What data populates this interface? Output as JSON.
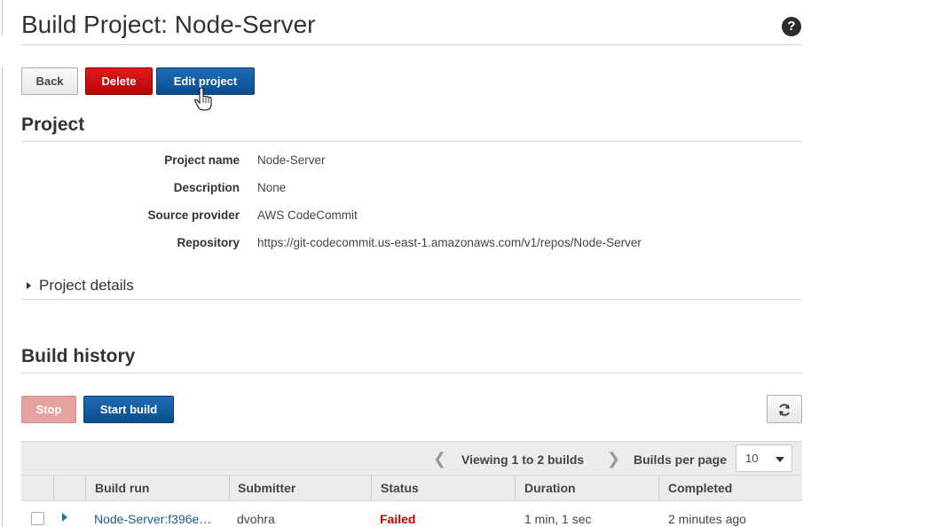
{
  "page": {
    "title": "Build Project: Node-Server",
    "help_icon": "question-circle-icon"
  },
  "actions": {
    "back_label": "Back",
    "delete_label": "Delete",
    "edit_label": "Edit project"
  },
  "project": {
    "section_title": "Project",
    "fields": [
      {
        "label": "Project name",
        "value": "Node-Server"
      },
      {
        "label": "Description",
        "value": "None"
      },
      {
        "label": "Source provider",
        "value": "AWS CodeCommit"
      },
      {
        "label": "Repository",
        "value": "https://git-codecommit.us-east-1.amazonaws.com/v1/repos/Node-Server"
      }
    ],
    "details_label": "Project details"
  },
  "build_history": {
    "section_title": "Build history",
    "stop_label": "Stop",
    "start_label": "Start build",
    "refresh_icon": "refresh-icon",
    "viewing_text": "Viewing 1 to 2 builds",
    "per_page_label": "Builds per page",
    "per_page_value": "10",
    "columns": [
      "Build run",
      "Submitter",
      "Status",
      "Duration",
      "Completed"
    ],
    "rows": [
      {
        "build_run": "Node-Server:f396e…",
        "submitter": "dvohra",
        "status": "Failed",
        "duration": "1 min, 1 sec",
        "completed": "2 minutes ago"
      }
    ]
  },
  "colors": {
    "primary": "#1f6cb5",
    "danger": "#c00000",
    "link": "#1e5a8e"
  }
}
